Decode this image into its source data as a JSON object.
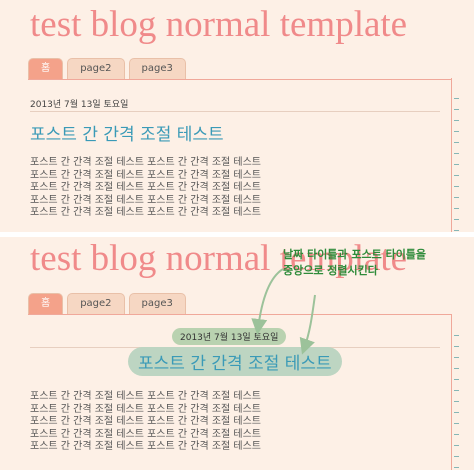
{
  "blog": {
    "title": "test blog normal template"
  },
  "tabs": [
    {
      "label": "홈",
      "active": true
    },
    {
      "label": "page2",
      "active": false
    },
    {
      "label": "page3",
      "active": false
    }
  ],
  "post": {
    "date": "2013년 7월 13일 토요일",
    "title": "포스트 간 간격 조절 테스트",
    "body_lines": [
      "포스트 간 간격 조절 테스트 포스트 간 간격 조절 테스트",
      "포스트 간 간격 조절 테스트 포스트 간 간격 조절 테스트",
      "포스트 간 간격 조절 테스트 포스트 간 간격 조절 테스트",
      "포스트 간 간격 조절 테스트 포스트 간 간격 조절 테스트",
      "포스트 간 간격 조절 테스트 포스트 간 간격 조절 테스트"
    ]
  },
  "annotation": {
    "line1": "날짜 타이틀과 포스트 타이틀을",
    "line2": "중앙으로 정렬시킨다"
  },
  "colors": {
    "title": "#f08a8a",
    "accent_tab": "#f4a28a",
    "post_title": "#3a9ab7",
    "annotation": "#2e8b3a",
    "background": "#fdf0e6"
  }
}
